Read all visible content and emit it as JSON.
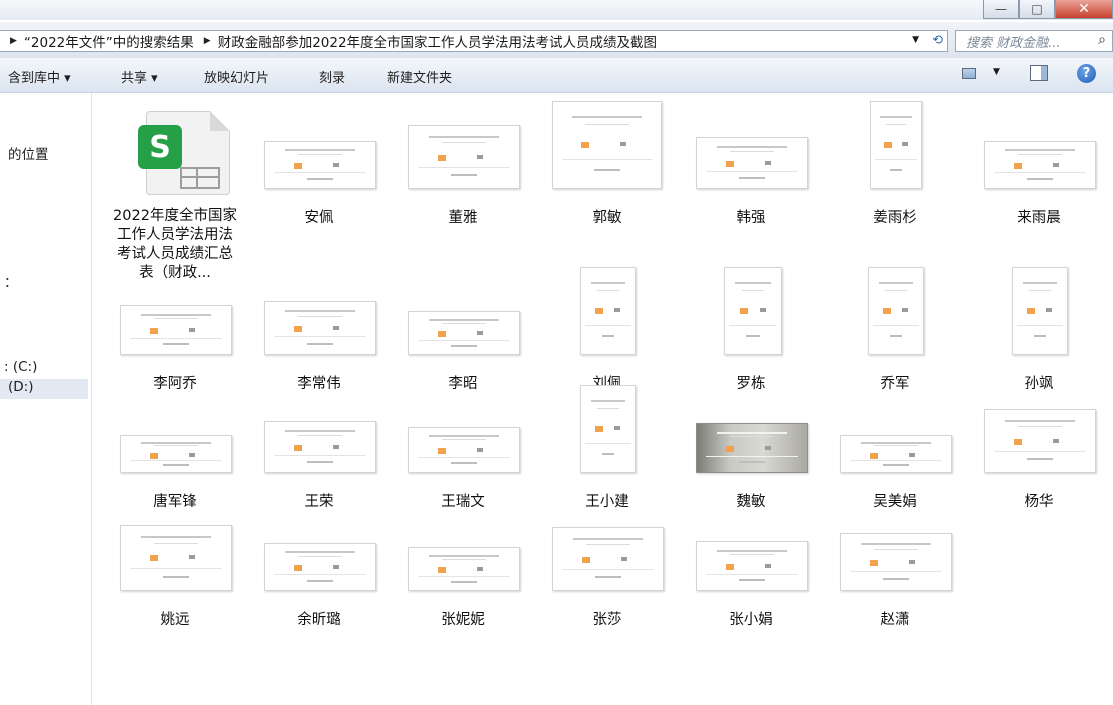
{
  "window": {
    "minimize_label": "—",
    "maximize_label": "□",
    "close_label": "✕"
  },
  "address": {
    "crumbs": [
      "“2022年文件”中的搜索结果",
      "财政金融部参加2022年度全市国家工作人员学法用法考试人员成绩及截图"
    ],
    "separator": "▶",
    "dropdown": "▼",
    "refresh": "⟲"
  },
  "search": {
    "placeholder": "搜索 财政金融...",
    "icon": "⌕"
  },
  "toolbar": {
    "include_library": "含到库中 ▾",
    "share": "共享 ▾",
    "slideshow": "放映幻灯片",
    "burn": "刻录",
    "new_folder": "新建文件夹",
    "view_dropdown": "▼",
    "help": "?"
  },
  "nav": {
    "items": [
      {
        "label": "的位置"
      },
      {
        "label": "："
      },
      {
        "label": ": (C:)"
      },
      {
        "label": "(D:)"
      }
    ]
  },
  "files": [
    {
      "name": "2022年度全市国家工作人员学法用法考试人员成绩汇总表（财政...",
      "type": "spreadsheet",
      "icon": "S"
    },
    {
      "name": "安佩",
      "type": "image"
    },
    {
      "name": "董雅",
      "type": "image"
    },
    {
      "name": "郭敏",
      "type": "image"
    },
    {
      "name": "韩强",
      "type": "image"
    },
    {
      "name": "姜雨杉",
      "type": "image"
    },
    {
      "name": "来雨晨",
      "type": "image"
    },
    {
      "name": "李阿乔",
      "type": "image"
    },
    {
      "name": "李常伟",
      "type": "image"
    },
    {
      "name": "李昭",
      "type": "image"
    },
    {
      "name": "刘佩",
      "type": "image"
    },
    {
      "name": "罗栋",
      "type": "image"
    },
    {
      "name": "乔军",
      "type": "image"
    },
    {
      "name": "孙飒",
      "type": "image"
    },
    {
      "name": "唐军锋",
      "type": "image"
    },
    {
      "name": "王荣",
      "type": "image"
    },
    {
      "name": "王瑞文",
      "type": "image"
    },
    {
      "name": "王小建",
      "type": "image"
    },
    {
      "name": "魏敏",
      "type": "image"
    },
    {
      "name": "吴美娟",
      "type": "image"
    },
    {
      "name": "杨华",
      "type": "image"
    },
    {
      "name": "姚远",
      "type": "image"
    },
    {
      "name": "余昕璐",
      "type": "image"
    },
    {
      "name": "张妮妮",
      "type": "image"
    },
    {
      "name": "张莎",
      "type": "image"
    },
    {
      "name": "张小娟",
      "type": "image"
    },
    {
      "name": "赵潇",
      "type": "image"
    }
  ]
}
